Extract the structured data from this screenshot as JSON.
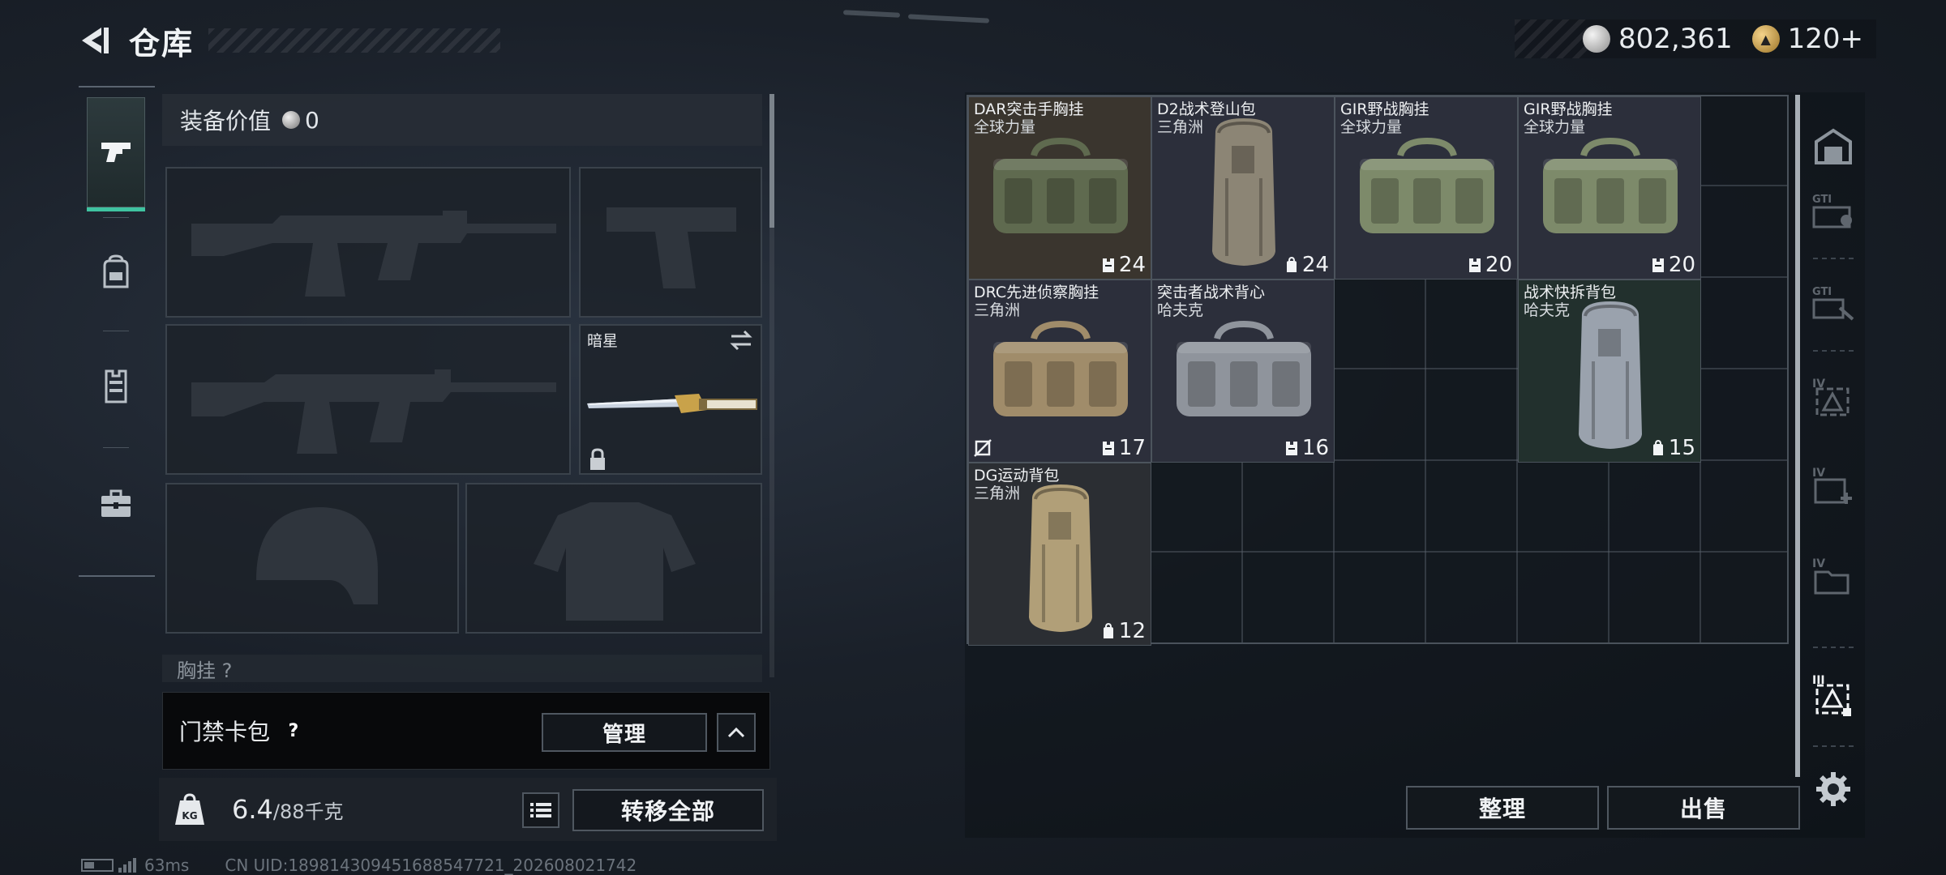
{
  "header": {
    "title": "仓库"
  },
  "currencies": [
    {
      "icon": "silver-coin-icon",
      "value": "802,361"
    },
    {
      "icon": "gold-coin-icon",
      "value": "120+"
    }
  ],
  "left_tabs": [
    "gun-icon",
    "backpack-icon",
    "vest-icon",
    "toolbox-icon"
  ],
  "equipment": {
    "value_label": "装备价值",
    "value": "0",
    "melee_name": "暗星",
    "chest_label": "胸挂",
    "keycard_label": "门禁卡包",
    "help_symbol": "?",
    "manage_label": "管理",
    "weight_current": "6.4",
    "weight_max": "/88千克",
    "transfer_all_label": "转移全部"
  },
  "storage_items": [
    {
      "name": "DAR突击手胸挂",
      "sub": "全球力量",
      "capacity": "24",
      "cap_icon": "vest-icon",
      "art": "duffel",
      "tone": "#3a352e",
      "bag": "#5f6a4f"
    },
    {
      "name": "D2战术登山包",
      "sub": "三角洲",
      "capacity": "24",
      "cap_icon": "backpack-icon",
      "art": "tall",
      "tone": "#2c2f3b",
      "bag": "#8c8575"
    },
    {
      "name": "GIR野战胸挂",
      "sub": "全球力量",
      "capacity": "20",
      "cap_icon": "vest-icon",
      "art": "duffel",
      "tone": "#2c2f3b",
      "bag": "#7d8a6a"
    },
    {
      "name": "GIR野战胸挂",
      "sub": "全球力量",
      "capacity": "20",
      "cap_icon": "vest-icon",
      "art": "duffel",
      "tone": "#2c2f3b",
      "bag": "#7d8a6a"
    },
    {
      "name": "DRC先进侦察胸挂",
      "sub": "三角洲",
      "capacity": "17",
      "cap_icon": "vest-icon",
      "art": "duffel",
      "tone": "#2c2f3b",
      "bag": "#a08c6a",
      "no_icon": true
    },
    {
      "name": "突击者战术背心",
      "sub": "哈夫克",
      "capacity": "16",
      "cap_icon": "vest-icon",
      "art": "duffel",
      "tone": "#2c2f3b",
      "bag": "#8f949c"
    },
    {
      "name": "战术快拆背包",
      "sub": "哈夫克",
      "capacity": "15",
      "cap_icon": "backpack-icon",
      "art": "tall",
      "tone": "#22302d",
      "bag": "#9aa2ad"
    },
    {
      "name": "DG运动背包",
      "sub": "三角洲",
      "capacity": "12",
      "cap_icon": "backpack-icon",
      "art": "tall",
      "tone": "#2b2e33",
      "bag": "#b19f78"
    }
  ],
  "actions": {
    "organize_label": "整理",
    "sell_label": "出售"
  },
  "right_tabs": [
    "safe-box-icon",
    "gti-case-icon",
    "gti-tool-icon",
    "tier4-box-icon",
    "tier4-medkit-icon",
    "tier4-folder-icon",
    "tier3-box-icon",
    "settings-icon"
  ],
  "status_bar": {
    "ping": "63ms",
    "uid": "CN UID:1898143094516885477​21_202608021742"
  },
  "colors": {
    "accent": "#3fc3a0",
    "panel": "#1c2128"
  }
}
